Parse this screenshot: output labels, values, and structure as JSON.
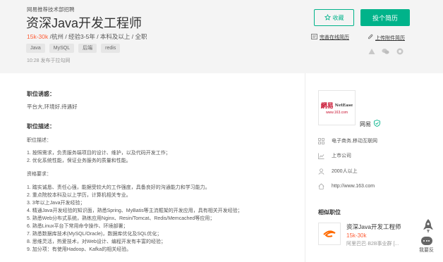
{
  "header": {
    "department": "网易推荐技术部招聘",
    "title": "资深Java开发工程师",
    "salary": "15k-30k",
    "requirements": " /杭州 / 经验3-5年 / 本科及以上 / 全职",
    "tags": [
      "Java",
      "MySQL",
      "后端",
      "redis"
    ],
    "posted": "10:28  发布于拉勾网",
    "fav_label": "收藏",
    "apply_label": "投个简历",
    "online_resume": "完善在线简历",
    "upload_resume": "上传附件简历"
  },
  "description": {
    "advantage_title": "职位诱惑：",
    "advantage_text": "平台大,环境好,待遇好",
    "desc_title": "职位描述：",
    "duties_head": "职位描述：",
    "duties": [
      "1. 按照需求，负责服务端项目的设计、维护，以及代码开发工作；",
      "2. 优化系统性能，保证业务服务的质量和性能。"
    ],
    "req_head": "资格要求：",
    "reqs": [
      "1. 踏实诚恳、责任心强，能据受较大的工作强度，具备良好的沟通能力和学习能力。",
      "2. 重点院校本科及以上学历，计算机相关专业。",
      "3. 3年以上Java开发经验；",
      "4. 精通Java开发经验的知识面，熟悉Spring、MyBatis等主流框架的开发应用，具有相关开发经验；",
      "5. 熟悉Web分布式系统，熟练应用Nginx、Resin/Tomcat、Redis/Memcached等应用；",
      "6. 熟悉Linux平台下常用命令操作、环境部署；",
      "7. 熟悉数据库技术(MySQL/Oracle)，数据库优化及SQL优化；",
      "8. 思维灵活，热爱技术，对Web设计、编程开发有丰富的经验；",
      "9. 加分项：有使用Hadoop、Kafka的相关经验。"
    ]
  },
  "company": {
    "logo_cn": "網易",
    "logo_en": "NetEase",
    "logo_url": "www.163.com",
    "name": "网易",
    "field": "电子商务,移动互联网",
    "stage": "上市公司",
    "size": "2000人以上",
    "website": "http://www.163.com"
  },
  "similar": {
    "title": "相似职位",
    "item_title": "资深Java开发工程师",
    "item_salary": "15k-30k",
    "item_company": "阿里巴巴·B2B事业群 [..."
  },
  "feedback_label": "我要反",
  "colors": {
    "accent": "#00b38a",
    "salary": "#fd5f39"
  }
}
